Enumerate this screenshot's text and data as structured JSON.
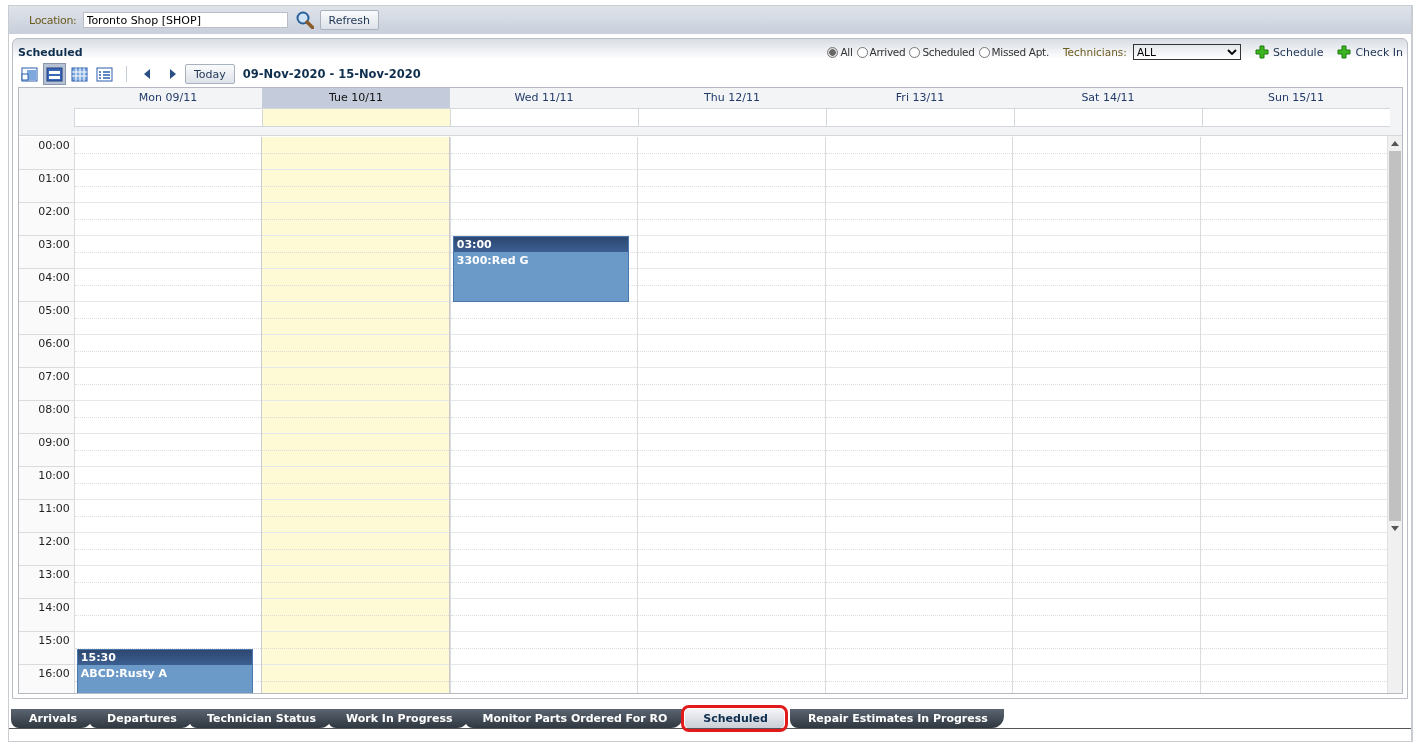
{
  "location": {
    "label": "Location:",
    "value": "Toronto Shop [SHOP]",
    "refresh": "Refresh"
  },
  "panel": {
    "title": "Scheduled",
    "filters": [
      {
        "label": "All",
        "selected": true
      },
      {
        "label": "Arrived",
        "selected": false
      },
      {
        "label": "Scheduled",
        "selected": false
      },
      {
        "label": "Missed Apt.",
        "selected": false
      }
    ],
    "technicians": {
      "label": "Technicians:",
      "value": "ALL"
    },
    "actions": [
      "Schedule",
      "Check In"
    ],
    "views": [
      {
        "selected": false
      },
      {
        "selected": true
      },
      {
        "selected": false
      },
      {
        "selected": false
      }
    ],
    "today": "Today",
    "range": "09-Nov-2020 - 15-Nov-2020"
  },
  "calendar": {
    "hours": [
      "00:00",
      "01:00",
      "02:00",
      "03:00",
      "04:00",
      "05:00",
      "06:00",
      "07:00",
      "08:00",
      "09:00",
      "10:00",
      "11:00",
      "12:00",
      "13:00",
      "14:00",
      "15:00",
      "16:00"
    ],
    "days": [
      {
        "label": "Mon 09/11",
        "selected": false,
        "events": [
          {
            "time": "15:30",
            "title": "ABCD:Rusty A"
          }
        ]
      },
      {
        "label": "Tue 10/11",
        "selected": true
      },
      {
        "label": "Wed 11/11",
        "selected": false,
        "events": [
          {
            "time": "03:00",
            "title": "3300:Red G"
          }
        ]
      },
      {
        "label": "Thu 12/11",
        "selected": false
      },
      {
        "label": "Fri 13/11",
        "selected": false
      },
      {
        "label": "Sat 14/11",
        "selected": false
      },
      {
        "label": "Sun 15/11",
        "selected": false
      }
    ]
  },
  "tabs": [
    {
      "label": "Arrivals",
      "selected": false
    },
    {
      "label": "Departures",
      "selected": false
    },
    {
      "label": "Technician Status",
      "selected": false
    },
    {
      "label": "Work In Progress",
      "selected": false
    },
    {
      "label": "Monitor Parts Ordered For RO",
      "selected": false
    },
    {
      "label": "Scheduled",
      "selected": true
    },
    {
      "label": "Repair Estimates In Progress",
      "selected": false
    }
  ]
}
